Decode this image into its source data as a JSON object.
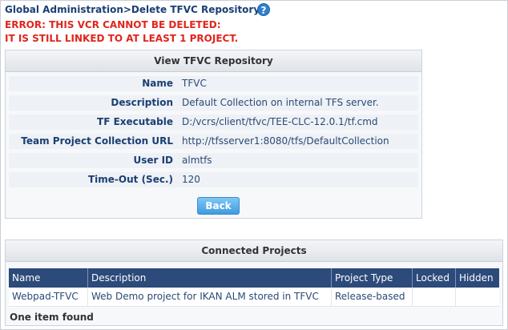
{
  "breadcrumb": "Global Administration>Delete TFVC Repository",
  "help": "?",
  "errors": [
    "ERROR: THIS VCR CANNOT BE DELETED:",
    "IT IS STILL LINKED TO AT LEAST 1 PROJECT."
  ],
  "view_panel": {
    "title": "View TFVC Repository",
    "fields": [
      {
        "label": "Name",
        "value": "TFVC"
      },
      {
        "label": "Description",
        "value": "Default Collection on internal TFS server."
      },
      {
        "label": "TF Executable",
        "value": "D:/vcrs/client/tfvc/TEE-CLC-12.0.1/tf.cmd"
      },
      {
        "label": "Team Project Collection URL",
        "value": "http://tfsserver1:8080/tfs/DefaultCollection"
      },
      {
        "label": "User ID",
        "value": "almtfs"
      },
      {
        "label": "Time-Out (Sec.)",
        "value": "120"
      }
    ],
    "back_label": "Back"
  },
  "connected_projects": {
    "title": "Connected Projects",
    "columns": [
      "Name",
      "Description",
      "Project Type",
      "Locked",
      "Hidden"
    ],
    "rows": [
      [
        "Webpad-TFVC",
        "Web Demo project for IKAN ALM stored in TFVC",
        "Release-based",
        "",
        ""
      ]
    ],
    "footer": "One item found"
  }
}
